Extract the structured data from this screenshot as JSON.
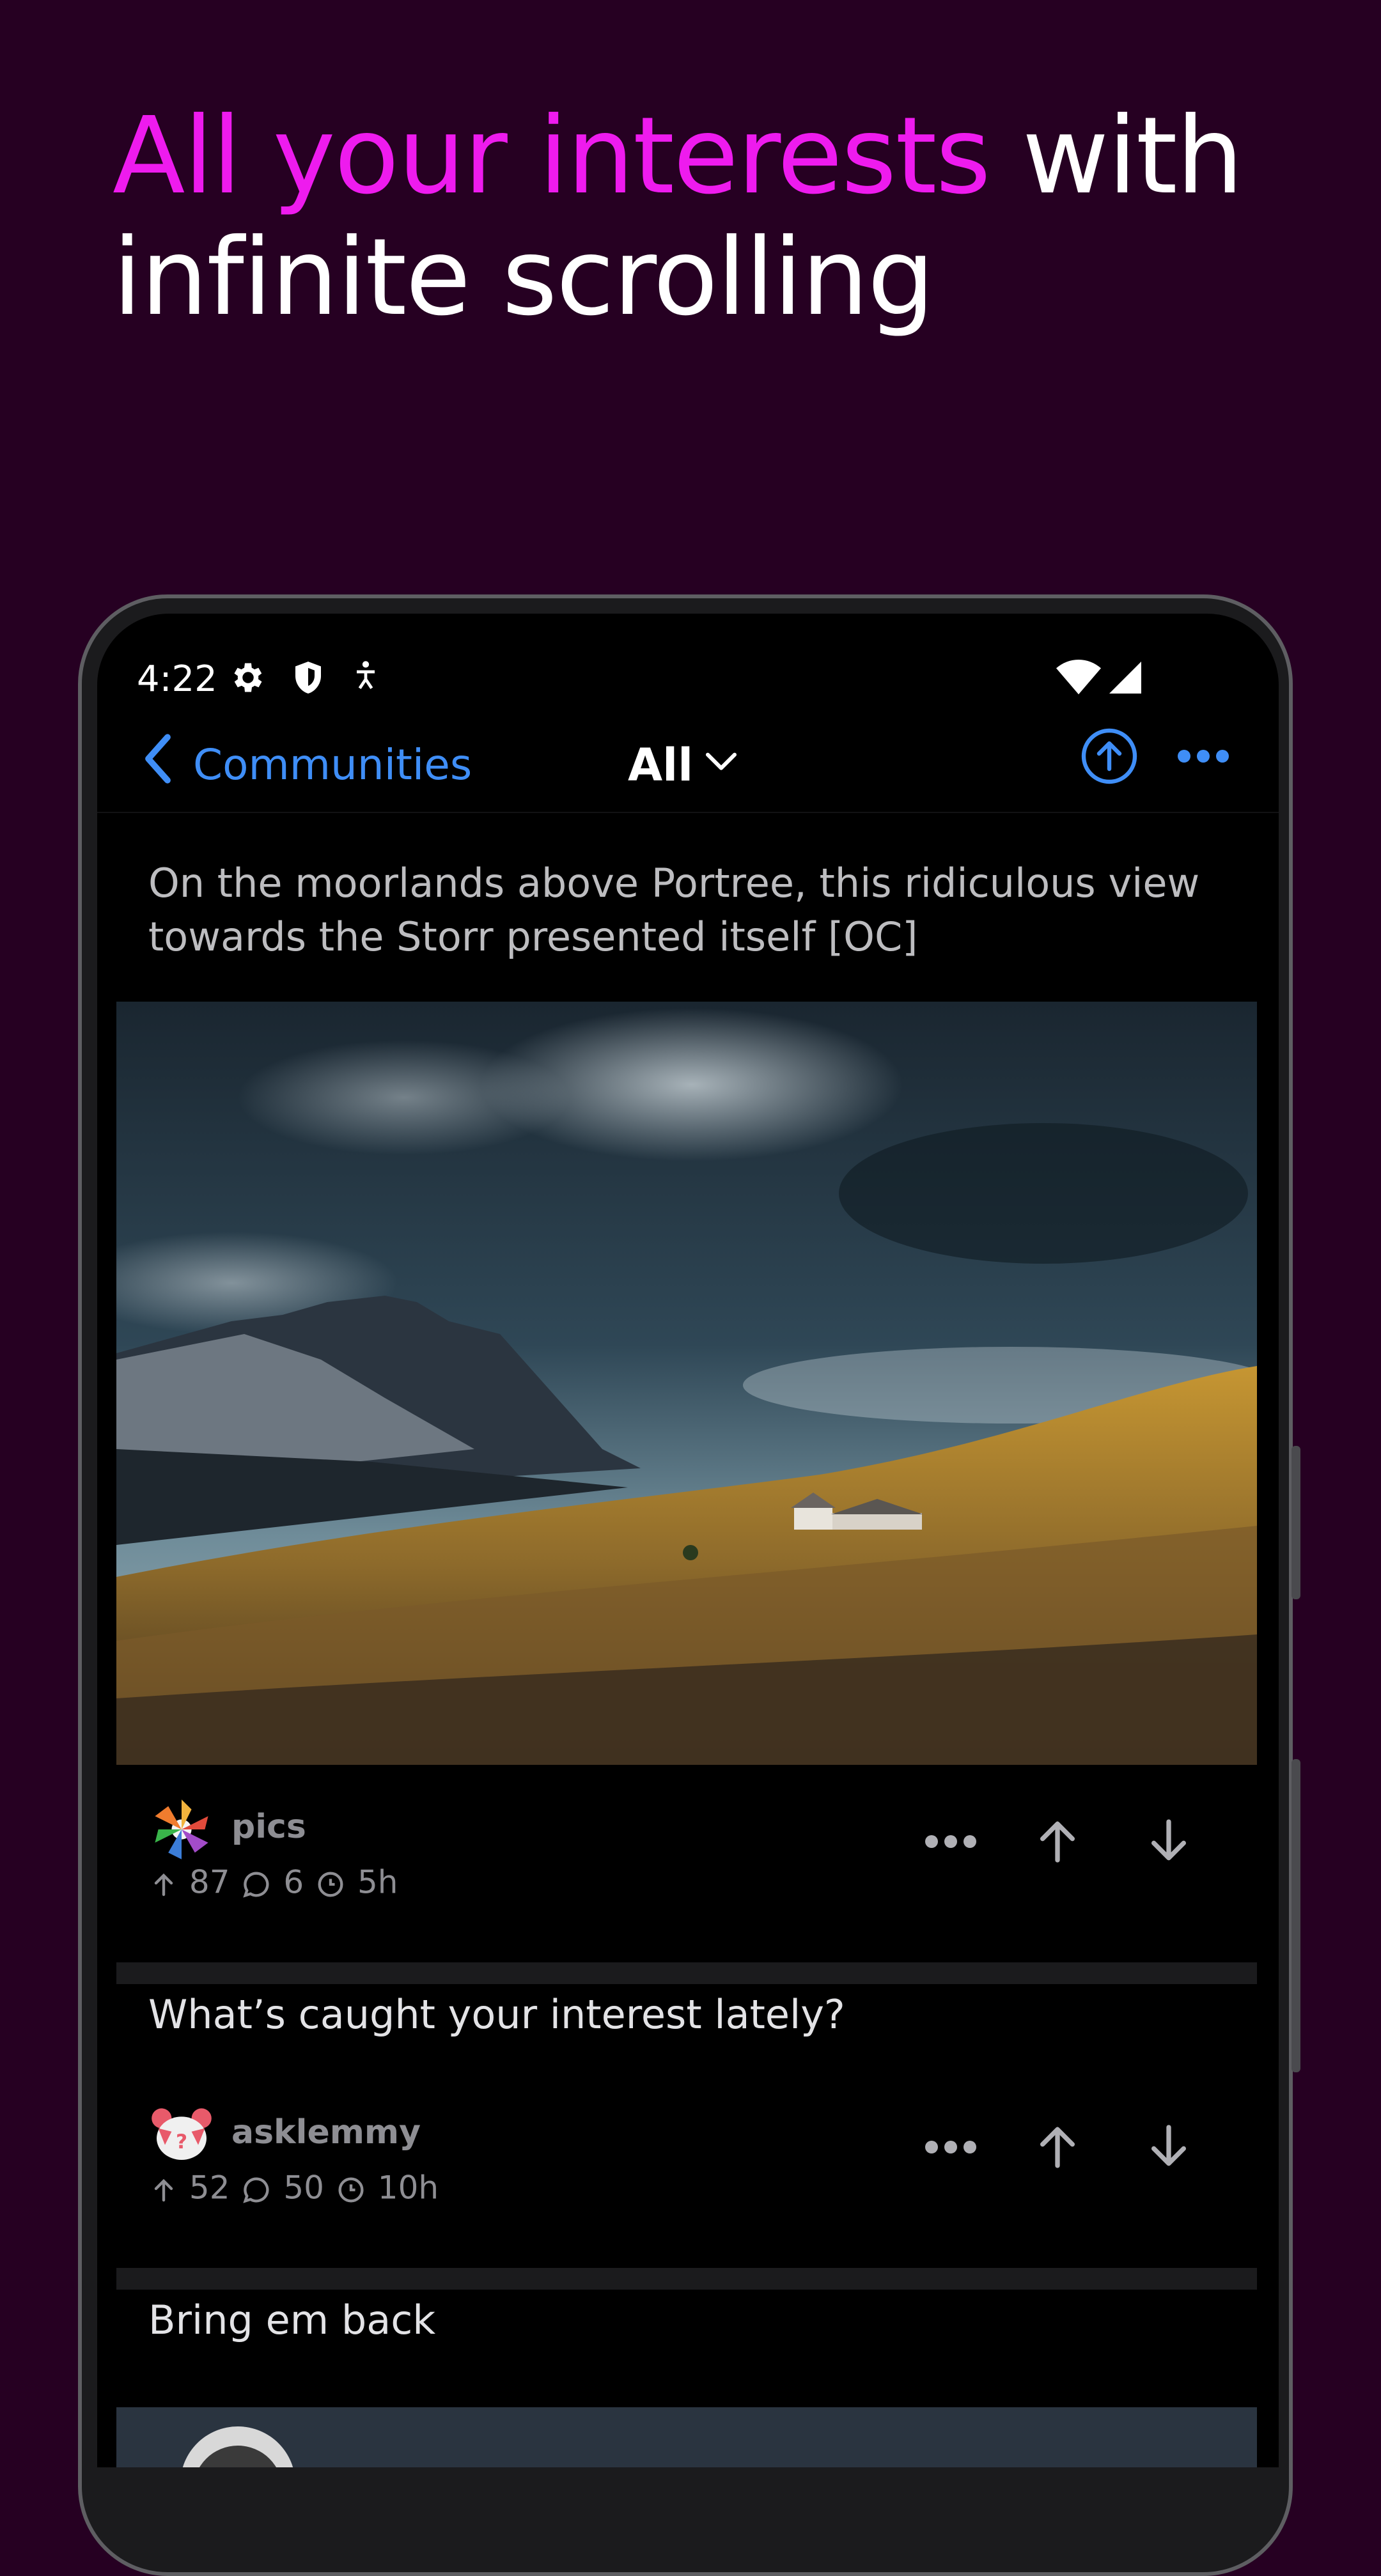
{
  "headline": {
    "accent": "All your interests",
    "rest_line1": " with",
    "line2": "infinite scrolling"
  },
  "status_bar": {
    "time": "4:22",
    "icons": [
      "gear-icon",
      "shield-icon",
      "accessibility-icon",
      "wifi-icon",
      "signal-icon"
    ]
  },
  "nav": {
    "back_label": "Communities",
    "title": "All",
    "icons": [
      "chevron-left-icon",
      "chevron-down-icon",
      "arrow-up-circle-icon",
      "more-horizontal-icon"
    ]
  },
  "posts": [
    {
      "title": "On the moorlands above Portree, this ridiculous view towards the Storr presented itself [OC]",
      "community": "pics",
      "score": "87",
      "comments": "6",
      "age": "5h",
      "has_image": true
    },
    {
      "title": "What’s caught your interest lately?",
      "community": "asklemmy",
      "score": "52",
      "comments": "50",
      "age": "10h"
    },
    {
      "title": "Bring em back"
    }
  ],
  "colors": {
    "background": "#260022",
    "accent": "#ee1bee",
    "link": "#3f8ef7",
    "muted": "#8e8e93"
  }
}
